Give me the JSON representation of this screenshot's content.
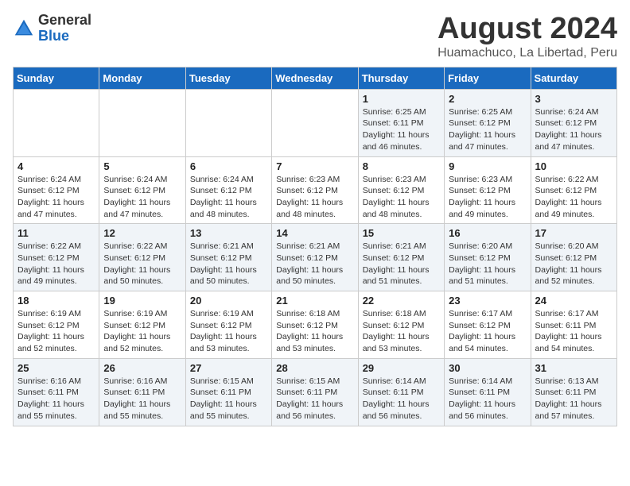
{
  "logo": {
    "general": "General",
    "blue": "Blue"
  },
  "title": "August 2024",
  "subtitle": "Huamachuco, La Libertad, Peru",
  "headers": [
    "Sunday",
    "Monday",
    "Tuesday",
    "Wednesday",
    "Thursday",
    "Friday",
    "Saturday"
  ],
  "weeks": [
    [
      {
        "day": "",
        "info": ""
      },
      {
        "day": "",
        "info": ""
      },
      {
        "day": "",
        "info": ""
      },
      {
        "day": "",
        "info": ""
      },
      {
        "day": "1",
        "info": "Sunrise: 6:25 AM\nSunset: 6:11 PM\nDaylight: 11 hours and 46 minutes."
      },
      {
        "day": "2",
        "info": "Sunrise: 6:25 AM\nSunset: 6:12 PM\nDaylight: 11 hours and 47 minutes."
      },
      {
        "day": "3",
        "info": "Sunrise: 6:24 AM\nSunset: 6:12 PM\nDaylight: 11 hours and 47 minutes."
      }
    ],
    [
      {
        "day": "4",
        "info": "Sunrise: 6:24 AM\nSunset: 6:12 PM\nDaylight: 11 hours and 47 minutes."
      },
      {
        "day": "5",
        "info": "Sunrise: 6:24 AM\nSunset: 6:12 PM\nDaylight: 11 hours and 47 minutes."
      },
      {
        "day": "6",
        "info": "Sunrise: 6:24 AM\nSunset: 6:12 PM\nDaylight: 11 hours and 48 minutes."
      },
      {
        "day": "7",
        "info": "Sunrise: 6:23 AM\nSunset: 6:12 PM\nDaylight: 11 hours and 48 minutes."
      },
      {
        "day": "8",
        "info": "Sunrise: 6:23 AM\nSunset: 6:12 PM\nDaylight: 11 hours and 48 minutes."
      },
      {
        "day": "9",
        "info": "Sunrise: 6:23 AM\nSunset: 6:12 PM\nDaylight: 11 hours and 49 minutes."
      },
      {
        "day": "10",
        "info": "Sunrise: 6:22 AM\nSunset: 6:12 PM\nDaylight: 11 hours and 49 minutes."
      }
    ],
    [
      {
        "day": "11",
        "info": "Sunrise: 6:22 AM\nSunset: 6:12 PM\nDaylight: 11 hours and 49 minutes."
      },
      {
        "day": "12",
        "info": "Sunrise: 6:22 AM\nSunset: 6:12 PM\nDaylight: 11 hours and 50 minutes."
      },
      {
        "day": "13",
        "info": "Sunrise: 6:21 AM\nSunset: 6:12 PM\nDaylight: 11 hours and 50 minutes."
      },
      {
        "day": "14",
        "info": "Sunrise: 6:21 AM\nSunset: 6:12 PM\nDaylight: 11 hours and 50 minutes."
      },
      {
        "day": "15",
        "info": "Sunrise: 6:21 AM\nSunset: 6:12 PM\nDaylight: 11 hours and 51 minutes."
      },
      {
        "day": "16",
        "info": "Sunrise: 6:20 AM\nSunset: 6:12 PM\nDaylight: 11 hours and 51 minutes."
      },
      {
        "day": "17",
        "info": "Sunrise: 6:20 AM\nSunset: 6:12 PM\nDaylight: 11 hours and 52 minutes."
      }
    ],
    [
      {
        "day": "18",
        "info": "Sunrise: 6:19 AM\nSunset: 6:12 PM\nDaylight: 11 hours and 52 minutes."
      },
      {
        "day": "19",
        "info": "Sunrise: 6:19 AM\nSunset: 6:12 PM\nDaylight: 11 hours and 52 minutes."
      },
      {
        "day": "20",
        "info": "Sunrise: 6:19 AM\nSunset: 6:12 PM\nDaylight: 11 hours and 53 minutes."
      },
      {
        "day": "21",
        "info": "Sunrise: 6:18 AM\nSunset: 6:12 PM\nDaylight: 11 hours and 53 minutes."
      },
      {
        "day": "22",
        "info": "Sunrise: 6:18 AM\nSunset: 6:12 PM\nDaylight: 11 hours and 53 minutes."
      },
      {
        "day": "23",
        "info": "Sunrise: 6:17 AM\nSunset: 6:12 PM\nDaylight: 11 hours and 54 minutes."
      },
      {
        "day": "24",
        "info": "Sunrise: 6:17 AM\nSunset: 6:11 PM\nDaylight: 11 hours and 54 minutes."
      }
    ],
    [
      {
        "day": "25",
        "info": "Sunrise: 6:16 AM\nSunset: 6:11 PM\nDaylight: 11 hours and 55 minutes."
      },
      {
        "day": "26",
        "info": "Sunrise: 6:16 AM\nSunset: 6:11 PM\nDaylight: 11 hours and 55 minutes."
      },
      {
        "day": "27",
        "info": "Sunrise: 6:15 AM\nSunset: 6:11 PM\nDaylight: 11 hours and 55 minutes."
      },
      {
        "day": "28",
        "info": "Sunrise: 6:15 AM\nSunset: 6:11 PM\nDaylight: 11 hours and 56 minutes."
      },
      {
        "day": "29",
        "info": "Sunrise: 6:14 AM\nSunset: 6:11 PM\nDaylight: 11 hours and 56 minutes."
      },
      {
        "day": "30",
        "info": "Sunrise: 6:14 AM\nSunset: 6:11 PM\nDaylight: 11 hours and 56 minutes."
      },
      {
        "day": "31",
        "info": "Sunrise: 6:13 AM\nSunset: 6:11 PM\nDaylight: 11 hours and 57 minutes."
      }
    ]
  ]
}
